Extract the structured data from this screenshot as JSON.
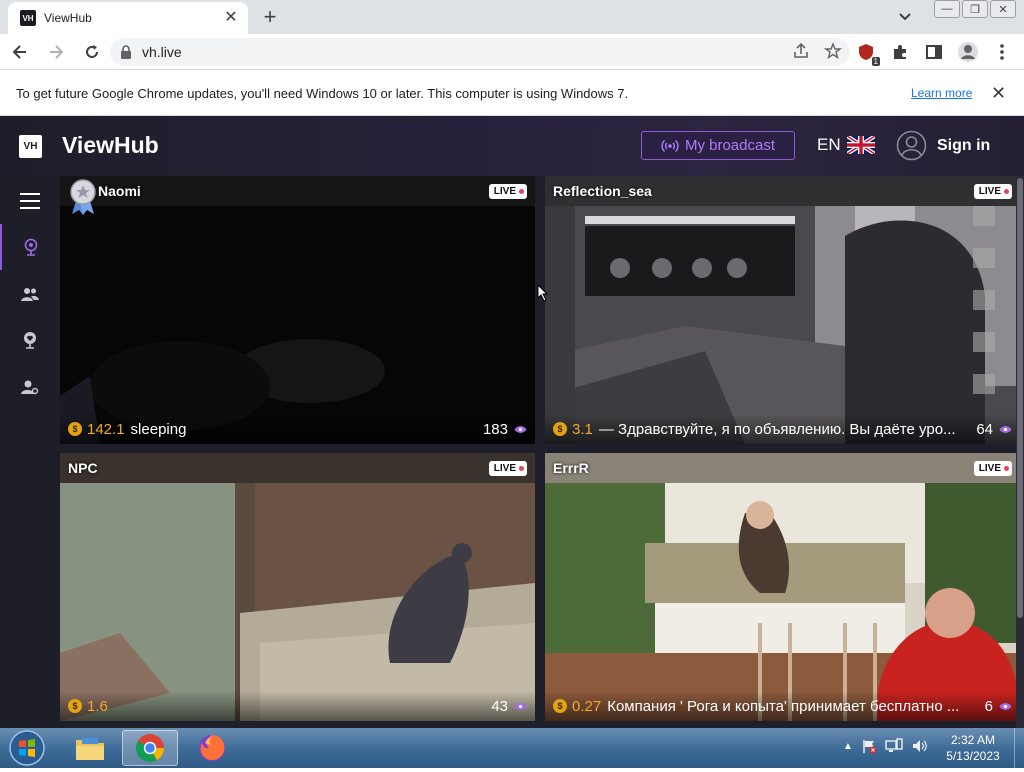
{
  "browser": {
    "tab_title": "ViewHub",
    "favicon_text": "VH",
    "address": "vh.live",
    "extension_badge": "1"
  },
  "infobar": {
    "message": "To get future Google Chrome updates, you'll need Windows 10 or later. This computer is using Windows 7.",
    "link": "Learn more"
  },
  "site": {
    "logo_box": "VH",
    "logo_text": "ViewHub",
    "broadcast_label": "My broadcast",
    "language": "EN",
    "signin_label": "Sign in",
    "accent": "#8e5ad6",
    "price_color": "#f0a92a"
  },
  "streams": [
    {
      "name": "Naomi",
      "live": "LIVE",
      "price": "142.1",
      "topic": "sleeping",
      "viewers": "183"
    },
    {
      "name": "Reflection_sea",
      "live": "LIVE",
      "price": "3.1",
      "topic": "— Здравствуйте, я по объявлению. Вы даёте уро...",
      "viewers": "64"
    },
    {
      "name": "NPC",
      "live": "LIVE",
      "price": "1.6",
      "topic": "",
      "viewers": "43"
    },
    {
      "name": "ErrrR",
      "live": "LIVE",
      "price": "0.27",
      "topic": "Компания ' Рога и копыта' принимает бесплатно ...",
      "viewers": "6"
    }
  ],
  "taskbar": {
    "time": "2:32 AM",
    "date": "5/13/2023"
  }
}
